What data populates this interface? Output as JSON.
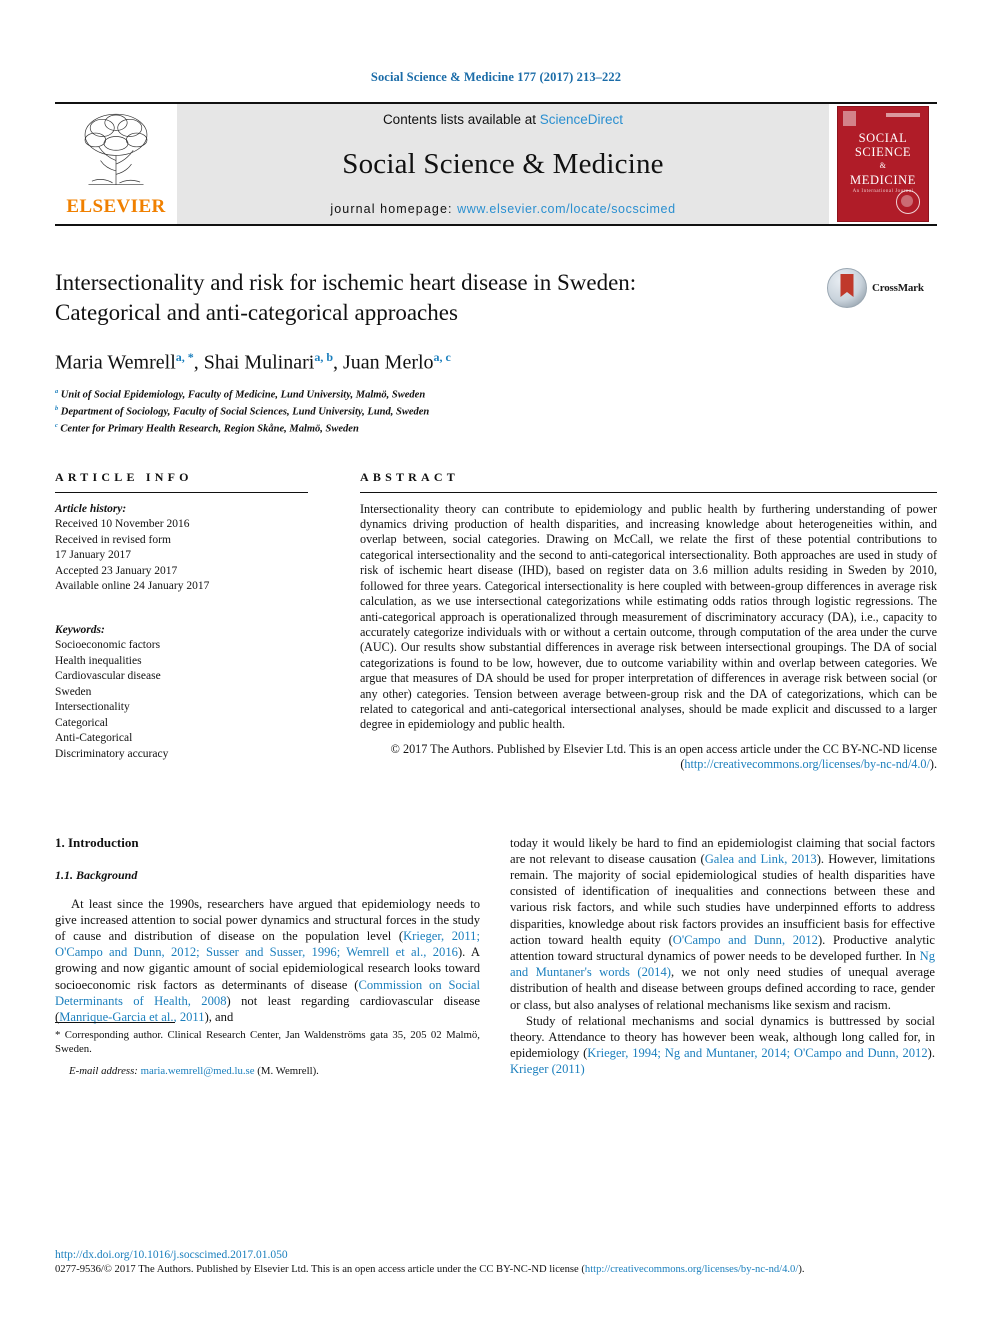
{
  "running_head": "Social Science & Medicine 177 (2017) 213–222",
  "masthead": {
    "publisher_name": "ELSEVIER",
    "contents_prefix": "Contents lists available at ",
    "contents_link": "ScienceDirect",
    "journal_title": "Social Science & Medicine",
    "homepage_prefix": "journal homepage: ",
    "homepage_url": "www.elsevier.com/locate/socscimed",
    "cover": {
      "line1": "SOCIAL",
      "line2": "SCIENCE",
      "amp": "&",
      "line3": "MEDICINE",
      "subtitle": "An International Journal"
    }
  },
  "crossmark": {
    "label": "CrossMark"
  },
  "article": {
    "title_line1": "Intersectionality and risk for ischemic heart disease in Sweden:",
    "title_line2": "Categorical and anti-categorical approaches",
    "authors": [
      {
        "name": "Maria Wemrell",
        "marks": "a, *"
      },
      {
        "name": "Shai Mulinari",
        "marks": "a, b"
      },
      {
        "name": "Juan Merlo",
        "marks": "a, c"
      }
    ],
    "affiliations": [
      {
        "mark": "a",
        "text": "Unit of Social Epidemiology, Faculty of Medicine, Lund University, Malmö, Sweden"
      },
      {
        "mark": "b",
        "text": "Department of Sociology, Faculty of Social Sciences, Lund University, Lund, Sweden"
      },
      {
        "mark": "c",
        "text": "Center for Primary Health Research, Region Skåne, Malmö, Sweden"
      }
    ]
  },
  "article_info": {
    "heading": "ARTICLE INFO",
    "history_label": "Article history:",
    "history": [
      "Received 10 November 2016",
      "Received in revised form",
      "17 January 2017",
      "Accepted 23 January 2017",
      "Available online 24 January 2017"
    ],
    "keywords_label": "Keywords:",
    "keywords": [
      "Socioeconomic factors",
      "Health inequalities",
      "Cardiovascular disease",
      "Sweden",
      "Intersectionality",
      "Categorical",
      "Anti-Categorical",
      "Discriminatory accuracy"
    ]
  },
  "abstract": {
    "heading": "ABSTRACT",
    "text": "Intersectionality theory can contribute to epidemiology and public health by furthering understanding of power dynamics driving production of health disparities, and increasing knowledge about heterogeneities within, and overlap between, social categories. Drawing on McCall, we relate the first of these potential contributions to categorical intersectionality and the second to anti-categorical intersectionality. Both approaches are used in study of risk of ischemic heart disease (IHD), based on register data on 3.6 million adults residing in Sweden by 2010, followed for three years. Categorical intersectionality is here coupled with between-group differences in average risk calculation, as we use intersectional categorizations while estimating odds ratios through logistic regressions. The anti-categorical approach is operationalized through measurement of discriminatory accuracy (DA), i.e., capacity to accurately categorize individuals with or without a certain outcome, through computation of the area under the curve (AUC). Our results show substantial differences in average risk between intersectional groupings. The DA of social categorizations is found to be low, however, due to outcome variability within and overlap between categories. We argue that measures of DA should be used for proper interpretation of differences in average risk between social (or any other) categories. Tension between average between-group risk and the DA of categorizations, which can be related to categorical and anti-categorical intersectional analyses, should be made explicit and discussed to a larger degree in epidemiology and public health.",
    "copyright_prefix": "© 2017 The Authors. Published by Elsevier Ltd. This is an open access article under the CC BY-NC-ND license (",
    "copyright_link": "http://creativecommons.org/licenses/by-nc-nd/4.0/",
    "copyright_suffix": ")."
  },
  "body": {
    "section1_heading": "1. Introduction",
    "section11_heading": "1.1. Background",
    "left_paragraph_1": {
      "seg1": "At least since the 1990s, researchers have argued that epidemiology needs to give increased attention to social power dynamics and structural forces in the study of cause and distribution of disease on the population level (",
      "cite1": "Krieger, 2011; O'Campo and Dunn, 2012; Susser and Susser, 1996; Wemrell et al., 2016",
      "seg2": "). A growing and now gigantic amount of social epidemiological research looks toward socioeconomic risk factors as determinants of disease (",
      "cite2": "Commission on Social Determinants of Health, 2008",
      "seg3": ") not least regarding cardiovascular disease (",
      "cite3": "Manrique-Garcia et al., 2011",
      "seg4": "), and"
    },
    "right_paragraph_1": {
      "seg1": "today it would likely be hard to find an epidemiologist claiming that social factors are not relevant to disease causation (",
      "cite1": "Galea and Link, 2013",
      "seg2": "). However, limitations remain. The majority of social epidemiological studies of health disparities have consisted of identification of inequalities and connections between these and various risk factors, and while such studies have underpinned efforts to address disparities, knowledge about risk factors provides an insufficient basis for effective action toward health equity (",
      "cite2": "O'Campo and Dunn, 2012",
      "seg3": "). Productive analytic attention toward structural dynamics of power needs to be developed further. In ",
      "cite3": "Ng and Muntaner's words (2014)",
      "seg4": ", we not only need studies of unequal average distribution of health and disease between groups defined according to race, gender or class, but also analyses of relational mechanisms like sexism and racism."
    },
    "right_paragraph_2": {
      "seg1": "Study of relational mechanisms and social dynamics is buttressed by social theory. Attendance to theory has however been weak, although long called for, in epidemiology (",
      "cite1": "Krieger, 1994; Ng and Muntaner, 2014; O'Campo and Dunn, 2012",
      "seg2": "). ",
      "cite2": "Krieger (2011)"
    }
  },
  "footnotes": {
    "corresponding": "* Corresponding author. Clinical Research Center, Jan Waldenströms gata 35, 205 02 Malmö, Sweden.",
    "email_label": "E-mail address:",
    "email": "maria.wemrell@med.lu.se",
    "email_suffix": " (M. Wemrell)."
  },
  "page_footer": {
    "doi": "http://dx.doi.org/10.1016/j.socscimed.2017.01.050",
    "issn_prefix": "0277-9536/© 2017 The Authors. Published by Elsevier Ltd. This is an open access article under the CC BY-NC-ND license (",
    "issn_link": "http://creativecommons.org/licenses/by-nc-nd/4.0/",
    "issn_suffix": ")."
  },
  "colors": {
    "link_blue": "#1b7fbd",
    "sciencedirect_blue": "#2a8fd0",
    "elsevier_orange": "#F08000",
    "cover_red": "#b01c28"
  }
}
